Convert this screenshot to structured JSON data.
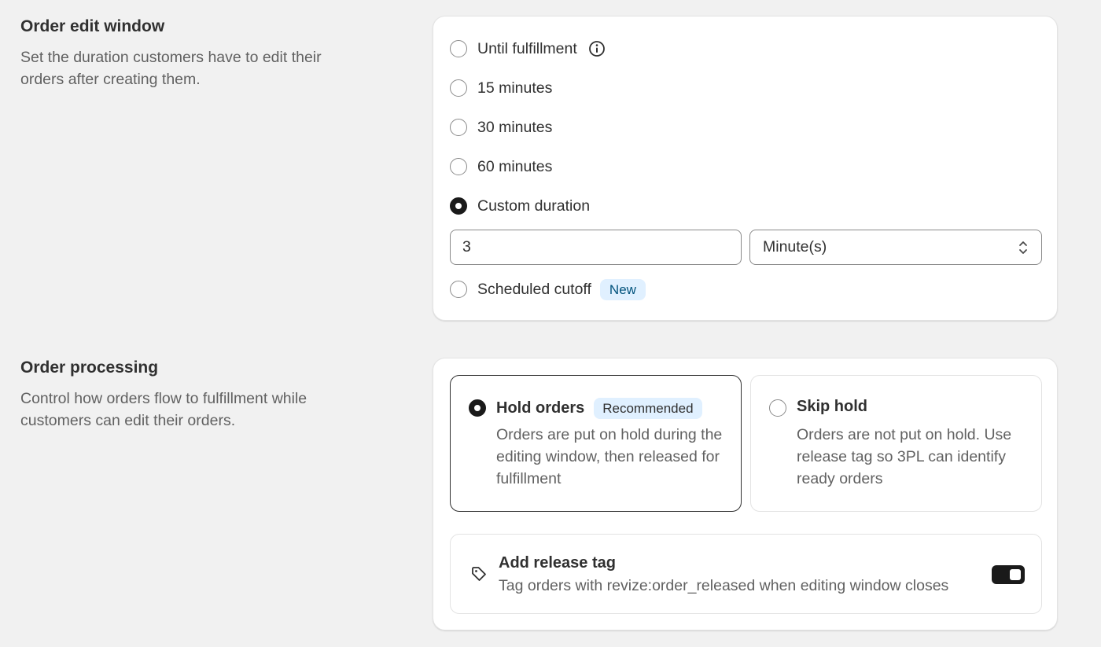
{
  "order_edit_window": {
    "title": "Order edit window",
    "description": "Set the duration customers have to edit their orders after creating them.",
    "options": [
      {
        "label": "Until fulfillment",
        "checked": false,
        "icon": "info-icon"
      },
      {
        "label": "15 minutes",
        "checked": false
      },
      {
        "label": "30 minutes",
        "checked": false
      },
      {
        "label": "60 minutes",
        "checked": false
      },
      {
        "label": "Custom duration",
        "checked": true
      },
      {
        "label": "Scheduled cutoff",
        "checked": false,
        "badge": "New"
      }
    ],
    "custom_duration": {
      "value": "3",
      "unit": "Minute(s)"
    }
  },
  "order_processing": {
    "title": "Order processing",
    "description": "Control how orders flow to fulfillment while customers can edit their orders.",
    "tiles": [
      {
        "title": "Hold orders",
        "badge": "Recommended",
        "description": "Orders are put on hold during the editing window, then released for fulfillment",
        "selected": true
      },
      {
        "title": "Skip hold",
        "description": "Orders are not put on hold. Use release tag so 3PL can identify ready orders",
        "selected": false
      }
    ],
    "release_tag": {
      "title": "Add release tag",
      "description": "Tag orders with revize:order_released when editing window closes",
      "enabled": true,
      "icon": "tag-icon"
    }
  }
}
